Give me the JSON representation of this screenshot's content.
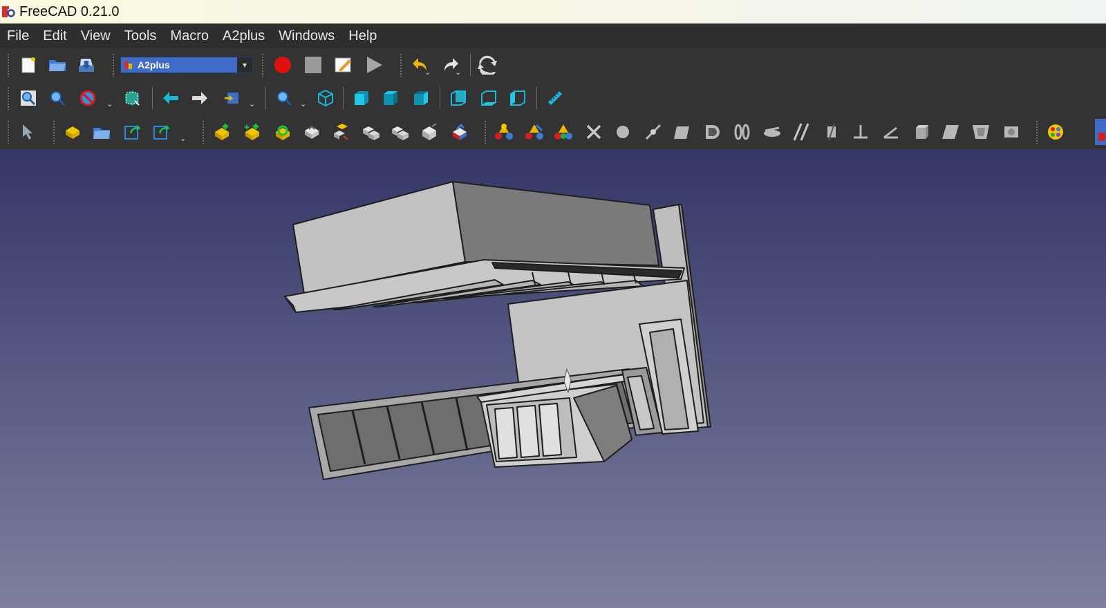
{
  "window": {
    "title": "FreeCAD 0.21.0"
  },
  "menubar": {
    "items": [
      "File",
      "Edit",
      "View",
      "Tools",
      "Macro",
      "A2plus",
      "Windows",
      "Help"
    ]
  },
  "toolbar_file": {
    "workbench_selector": {
      "value": "A2plus"
    },
    "icons": [
      "new-document-icon",
      "open-document-icon",
      "save-document-icon",
      "workbench-selector",
      "macro-record-icon",
      "macro-stop-icon",
      "macro-edit-icon",
      "macro-run-icon",
      "undo-icon",
      "redo-icon",
      "refresh-icon"
    ]
  },
  "toolbar_view": {
    "icons": [
      "fit-all-icon",
      "fit-selection-icon",
      "draw-style-icon",
      "bounding-box-icon",
      "back-icon",
      "forward-icon",
      "sync-view-icon",
      "std-views-icon",
      "isometric-icon",
      "front-view-icon",
      "top-view-icon",
      "right-view-icon",
      "rear-view-icon",
      "bottom-view-icon",
      "left-view-icon",
      "measure-distance-icon"
    ]
  },
  "toolbar_a2plus": {
    "icons": [
      "select-icon",
      "add-part-icon",
      "new-part-icon",
      "edit-part-icon",
      "duplicate-part-icon",
      "add-part-plus-icon",
      "add-part-green-icon",
      "update-imports-icon",
      "constraint-icon",
      "recompute-icon",
      "parts-list-icon",
      "solver-icon",
      "move-part-icon",
      "constraint-a-icon",
      "constraint-b-icon",
      "constraint-c-icon",
      "delete-constraints-icon",
      "point-identity-icon",
      "point-on-line-icon",
      "point-on-plane-icon",
      "circular-edge-icon",
      "axis-coincident-icon",
      "axis-parallel-icon",
      "axis-plane-parallel-icon",
      "angled-planes-icon",
      "plane-coincident-icon",
      "angle-icon",
      "perpendicular-icon",
      "plane-parallel-icon",
      "sphere-icon",
      "center-of-mass-icon",
      "cube-view-icon",
      "color-icon"
    ]
  },
  "viewport": {
    "background_top": "#343766",
    "background_bottom": "#7d7f9d",
    "model_color": "#b9b9b9"
  }
}
